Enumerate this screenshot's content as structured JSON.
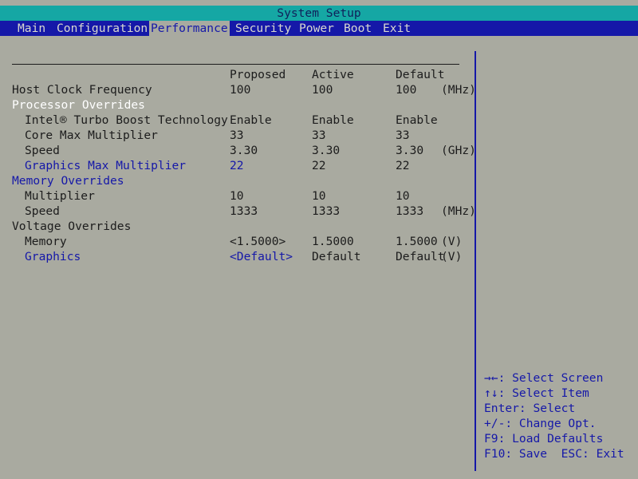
{
  "title": "System Setup",
  "menu": [
    "Main",
    "Configuration",
    "Performance",
    "Security",
    "Power",
    "Boot",
    "Exit"
  ],
  "columns": {
    "proposed": "Proposed",
    "active": "Active",
    "default": "Default"
  },
  "rows": [
    {
      "label": "Host Clock Frequency",
      "proposed": "100",
      "active": "100",
      "default": "100",
      "unit": "(MHz)"
    },
    {
      "label": "Processor Overrides"
    },
    {
      "label": "Intel® Turbo Boost Technology",
      "proposed": "Enable",
      "active": "Enable",
      "default": "Enable"
    },
    {
      "label": "Core Max Multiplier",
      "proposed": "33",
      "active": "33",
      "default": "33"
    },
    {
      "label": "Speed",
      "proposed": "3.30",
      "active": "3.30",
      "default": "3.30",
      "unit": "(GHz)"
    },
    {
      "label": "Graphics Max Multiplier",
      "proposed": "22",
      "active": "22",
      "default": "22"
    },
    {
      "label": "Memory Overrides"
    },
    {
      "label": "Multiplier",
      "proposed": "10",
      "active": "10",
      "default": "10"
    },
    {
      "label": "Speed",
      "proposed": "1333",
      "active": "1333",
      "default": "1333",
      "unit": "(MHz)"
    },
    {
      "label": "Voltage Overrides"
    },
    {
      "label": "Memory",
      "proposed": "<1.5000>",
      "active": "1.5000",
      "default": "1.5000",
      "unit": "(V)"
    },
    {
      "label": "Graphics",
      "proposed": "<Default>",
      "active": "Default",
      "default": "Default",
      "unit": "(V)"
    }
  ],
  "help": [
    "→←: Select Screen",
    "↑↓: Select Item",
    "Enter: Select",
    "+/-: Change Opt.",
    "F9: Load Defaults",
    "F10: Save  ESC: Exit"
  ],
  "colors": {
    "background": "#a9aaa0",
    "title_bar": "#15a7a4",
    "menu_bar": "#1518a8",
    "highlight_text": "#ffffff",
    "link_blue": "#1518a8"
  }
}
